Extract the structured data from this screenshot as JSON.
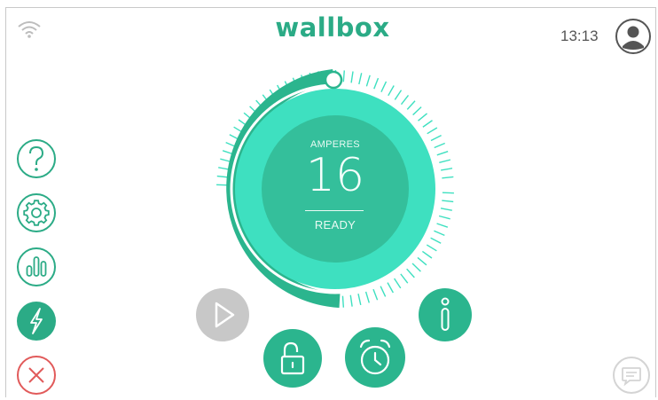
{
  "header": {
    "brand": "wallbox",
    "time": "13:13"
  },
  "icons": {
    "wifi": "wifi-icon",
    "user": "user-avatar-icon",
    "help": "question-mark-icon",
    "settings": "gear-icon",
    "stats": "bar-chart-icon",
    "charge": "lightning-icon",
    "close": "close-icon",
    "play": "play-icon",
    "lock": "unlocked-padlock-icon",
    "alarm": "alarm-clock-icon",
    "info": "info-icon",
    "chat": "chat-bubble-icon"
  },
  "gauge": {
    "label": "AMPERES",
    "value": "16",
    "status": "READY"
  },
  "colors": {
    "brand": "#2bab86",
    "accent_light": "#3ee0c0",
    "accent_dark": "#2bb58e",
    "disabled": "#c8c8c8",
    "danger": "#e15a5a"
  }
}
